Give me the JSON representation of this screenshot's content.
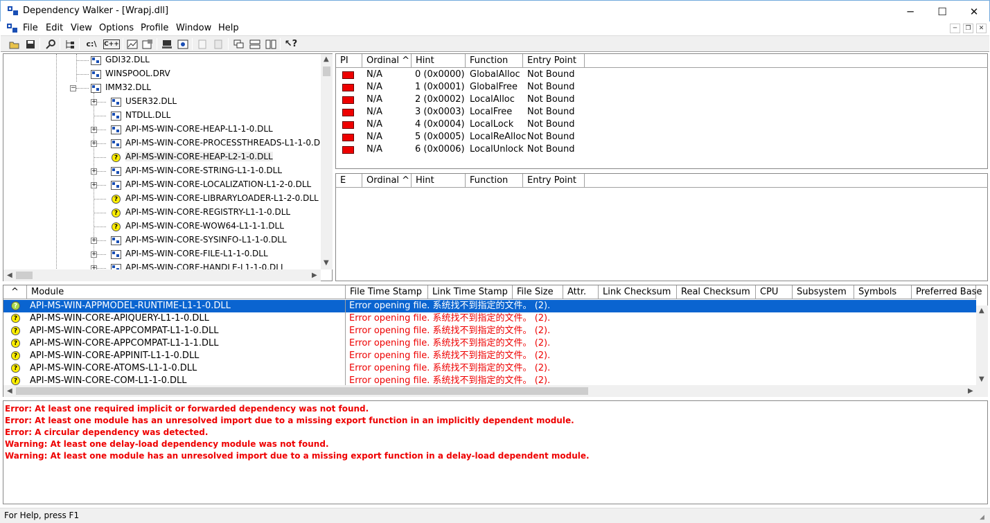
{
  "window": {
    "title": "Dependency Walker - [Wrapj.dll]",
    "minimize": "─",
    "maximize": "☐",
    "close": "✕"
  },
  "menu": [
    "File",
    "Edit",
    "View",
    "Options",
    "Profile",
    "Window",
    "Help"
  ],
  "toolbar_icons": [
    "open-icon",
    "save-icon",
    "find-icon",
    "tree-icon",
    "path-icon",
    "cpp-icon",
    "profile-icon",
    "properties-icon",
    "system-info-icon",
    "view-module-icon",
    "copy-icon",
    "paste-icon",
    "cascade-icon",
    "tile-horizontal-icon",
    "tile-vertical-icon",
    "help-icon"
  ],
  "toolbar_text": {
    "path": "c:\\",
    "cpp": "C++"
  },
  "tree": [
    {
      "label": "GDI32.DLL",
      "indent": 0,
      "icon": "dll",
      "plus": false
    },
    {
      "label": "WINSPOOL.DRV",
      "indent": 0,
      "icon": "dll",
      "plus": false
    },
    {
      "label": "IMM32.DLL",
      "indent": 0,
      "icon": "dll",
      "plus": "minus"
    },
    {
      "label": "USER32.DLL",
      "indent": 1,
      "icon": "dll",
      "plus": true
    },
    {
      "label": "NTDLL.DLL",
      "indent": 1,
      "icon": "dll",
      "plus": false
    },
    {
      "label": "API-MS-WIN-CORE-HEAP-L1-1-0.DLL",
      "indent": 1,
      "icon": "dll",
      "plus": true
    },
    {
      "label": "API-MS-WIN-CORE-PROCESSTHREADS-L1-1-0.D",
      "indent": 1,
      "icon": "dll",
      "plus": true
    },
    {
      "label": "API-MS-WIN-CORE-HEAP-L2-1-0.DLL",
      "indent": 1,
      "icon": "missing",
      "plus": false,
      "selected": true
    },
    {
      "label": "API-MS-WIN-CORE-STRING-L1-1-0.DLL",
      "indent": 1,
      "icon": "dll",
      "plus": true
    },
    {
      "label": "API-MS-WIN-CORE-LOCALIZATION-L1-2-0.DLL",
      "indent": 1,
      "icon": "dll",
      "plus": true
    },
    {
      "label": "API-MS-WIN-CORE-LIBRARYLOADER-L1-2-0.DLL",
      "indent": 1,
      "icon": "missing",
      "plus": false
    },
    {
      "label": "API-MS-WIN-CORE-REGISTRY-L1-1-0.DLL",
      "indent": 1,
      "icon": "missing",
      "plus": false
    },
    {
      "label": "API-MS-WIN-CORE-WOW64-L1-1-1.DLL",
      "indent": 1,
      "icon": "missing",
      "plus": false
    },
    {
      "label": "API-MS-WIN-CORE-SYSINFO-L1-1-0.DLL",
      "indent": 1,
      "icon": "dll",
      "plus": true
    },
    {
      "label": "API-MS-WIN-CORE-FILE-L1-1-0.DLL",
      "indent": 1,
      "icon": "dll",
      "plus": true
    },
    {
      "label": "API-MS-WIN-CORE-HANDLE-L1-1-0.DLL",
      "indent": 1,
      "icon": "dll",
      "plus": true
    }
  ],
  "imports": {
    "headers": [
      "PI",
      "Ordinal ^",
      "Hint",
      "Function",
      "Entry Point"
    ],
    "rows": [
      {
        "ordinal": "N/A",
        "hint": "0 (0x0000)",
        "function": "GlobalAlloc",
        "entry": "Not Bound"
      },
      {
        "ordinal": "N/A",
        "hint": "1 (0x0001)",
        "function": "GlobalFree",
        "entry": "Not Bound"
      },
      {
        "ordinal": "N/A",
        "hint": "2 (0x0002)",
        "function": "LocalAlloc",
        "entry": "Not Bound"
      },
      {
        "ordinal": "N/A",
        "hint": "3 (0x0003)",
        "function": "LocalFree",
        "entry": "Not Bound"
      },
      {
        "ordinal": "N/A",
        "hint": "4 (0x0004)",
        "function": "LocalLock",
        "entry": "Not Bound"
      },
      {
        "ordinal": "N/A",
        "hint": "5 (0x0005)",
        "function": "LocalReAlloc",
        "entry": "Not Bound"
      },
      {
        "ordinal": "N/A",
        "hint": "6 (0x0006)",
        "function": "LocalUnlock",
        "entry": "Not Bound"
      }
    ]
  },
  "exports": {
    "headers": [
      "E",
      "Ordinal ^",
      "Hint",
      "Function",
      "Entry Point"
    ]
  },
  "modules": {
    "headers": [
      "^",
      "Module",
      "File Time Stamp",
      "Link Time Stamp",
      "File Size",
      "Attr.",
      "Link Checksum",
      "Real Checksum",
      "CPU",
      "Subsystem",
      "Symbols",
      "Preferred Base"
    ],
    "error_text": "Error opening file. 系统找不到指定的文件。 (2).",
    "rows": [
      {
        "name": "API-MS-WIN-APPMODEL-RUNTIME-L1-1-0.DLL",
        "selected": true
      },
      {
        "name": "API-MS-WIN-CORE-APIQUERY-L1-1-0.DLL"
      },
      {
        "name": "API-MS-WIN-CORE-APPCOMPAT-L1-1-0.DLL"
      },
      {
        "name": "API-MS-WIN-CORE-APPCOMPAT-L1-1-1.DLL"
      },
      {
        "name": "API-MS-WIN-CORE-APPINIT-L1-1-0.DLL"
      },
      {
        "name": "API-MS-WIN-CORE-ATOMS-L1-1-0.DLL"
      },
      {
        "name": "API-MS-WIN-CORE-COM-L1-1-0.DLL"
      }
    ]
  },
  "log": [
    "Error: At least one required implicit or forwarded dependency was not found.",
    "Error: At least one module has an unresolved import due to a missing export function in an implicitly dependent module.",
    "Error: A circular dependency was detected.",
    "Warning: At least one delay-load dependency module was not found.",
    "Warning: At least one module has an unresolved import due to a missing export function in a delay-load dependent module."
  ],
  "status": "For Help, press F1",
  "colors": {
    "selection": "#0a64d0",
    "error": "#e00000",
    "pi_icon": "#e00000"
  }
}
